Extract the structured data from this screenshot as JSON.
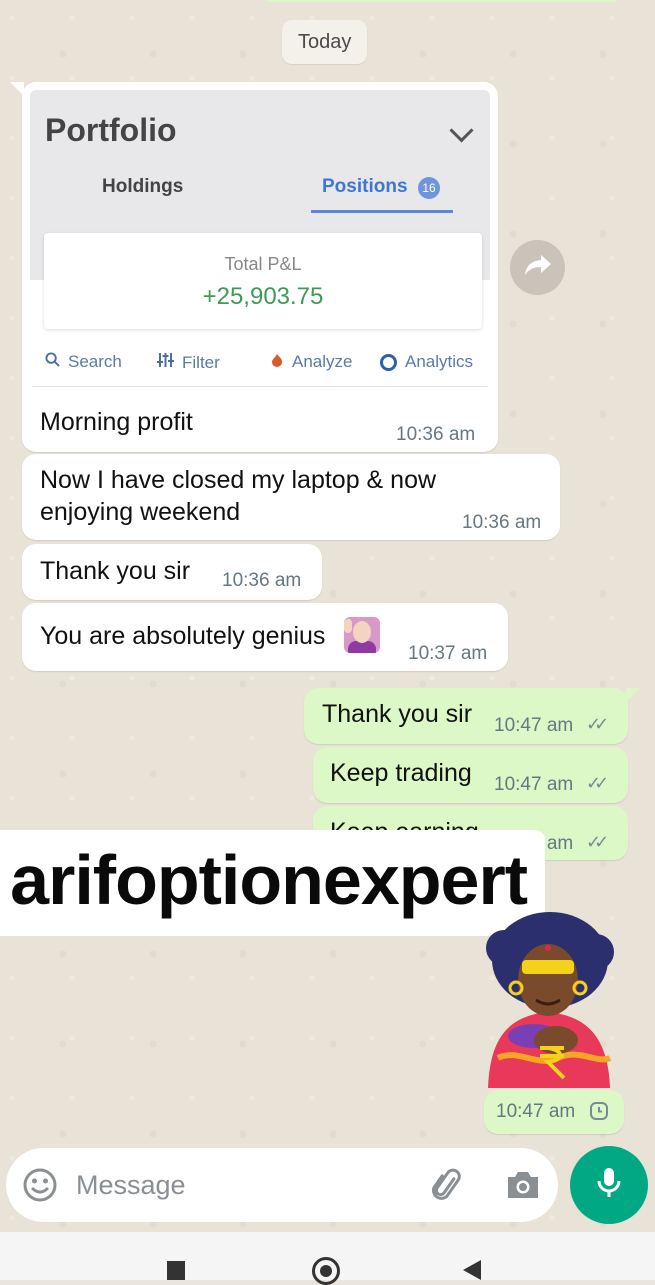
{
  "date_chip": "Today",
  "portfolio_card": {
    "title": "Portfolio",
    "tabs": [
      {
        "label": "Holdings"
      },
      {
        "label": "Positions",
        "badge": "16"
      }
    ],
    "pnl_label": "Total P&L",
    "pnl_value": "+25,903.75",
    "tools": [
      {
        "label": "Search",
        "icon": "search-icon"
      },
      {
        "label": "Filter",
        "icon": "filter-icon"
      },
      {
        "label": "Analyze",
        "icon": "flame-icon"
      },
      {
        "label": "Analytics",
        "icon": "analytics-icon"
      }
    ]
  },
  "messages": [
    {
      "direction": "in",
      "text": "Morning profit",
      "time": "10:36 am"
    },
    {
      "direction": "in",
      "text": "Now I have closed my laptop & now enjoying weekend",
      "line1": "Now I have closed my laptop & now",
      "line2": "enjoying weekend",
      "time": "10:36 am"
    },
    {
      "direction": "in",
      "text": "Thank you sir",
      "time": "10:36 am"
    },
    {
      "direction": "in",
      "text": "You are absolutely genius",
      "time": "10:37 am"
    },
    {
      "direction": "out",
      "text": "Thank you sir",
      "time": "10:47 am",
      "status": "read"
    },
    {
      "direction": "out",
      "text": "Keep trading",
      "time": "10:47 am",
      "status": "read"
    },
    {
      "direction": "out",
      "text": "Keep earning",
      "time": "10:47 am",
      "status": "read"
    },
    {
      "direction": "out",
      "sticker": true,
      "time": "10:47 am",
      "status": "pending"
    }
  ],
  "watermark": "arifoptionexpert",
  "composer": {
    "placeholder": "Message"
  },
  "colors": {
    "incoming_bubble": "#ffffff",
    "outgoing_bubble": "#dcf8c6",
    "accent": "#00a884",
    "pnl_green": "#3f9a57",
    "tab_active": "#3d77d6"
  }
}
